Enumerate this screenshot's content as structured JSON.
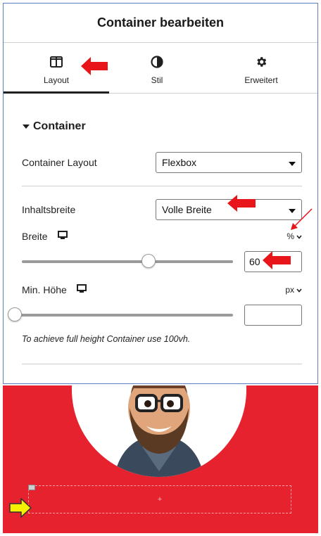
{
  "panel": {
    "title": "Container bearbeiten"
  },
  "tabs": [
    {
      "label": "Layout",
      "icon": "columns-icon",
      "active": true
    },
    {
      "label": "Stil",
      "icon": "contrast-icon",
      "active": false
    },
    {
      "label": "Erweitert",
      "icon": "gear-icon",
      "active": false
    }
  ],
  "section": {
    "title": "Container",
    "icon": "caret-down-icon"
  },
  "container_layout": {
    "label": "Container Layout",
    "value": "Flexbox"
  },
  "inhaltsbreite": {
    "label": "Inhaltsbreite",
    "value": "Volle Breite"
  },
  "breite": {
    "label": "Breite",
    "unit": "%",
    "value": "60",
    "slider_fraction": 0.6,
    "device_icon": "desktop-icon"
  },
  "min_hoehe": {
    "label": "Min. Höhe",
    "unit": "px",
    "value": "",
    "slider_fraction": 0,
    "device_icon": "desktop-icon"
  },
  "note": "To achieve full height Container use 100vh.",
  "preview": {
    "background": "#e5222d",
    "dropzone_plus": "+"
  },
  "colors": {
    "accent_arrow": "#e8151b",
    "pointer_arrow": "#f6f100"
  }
}
